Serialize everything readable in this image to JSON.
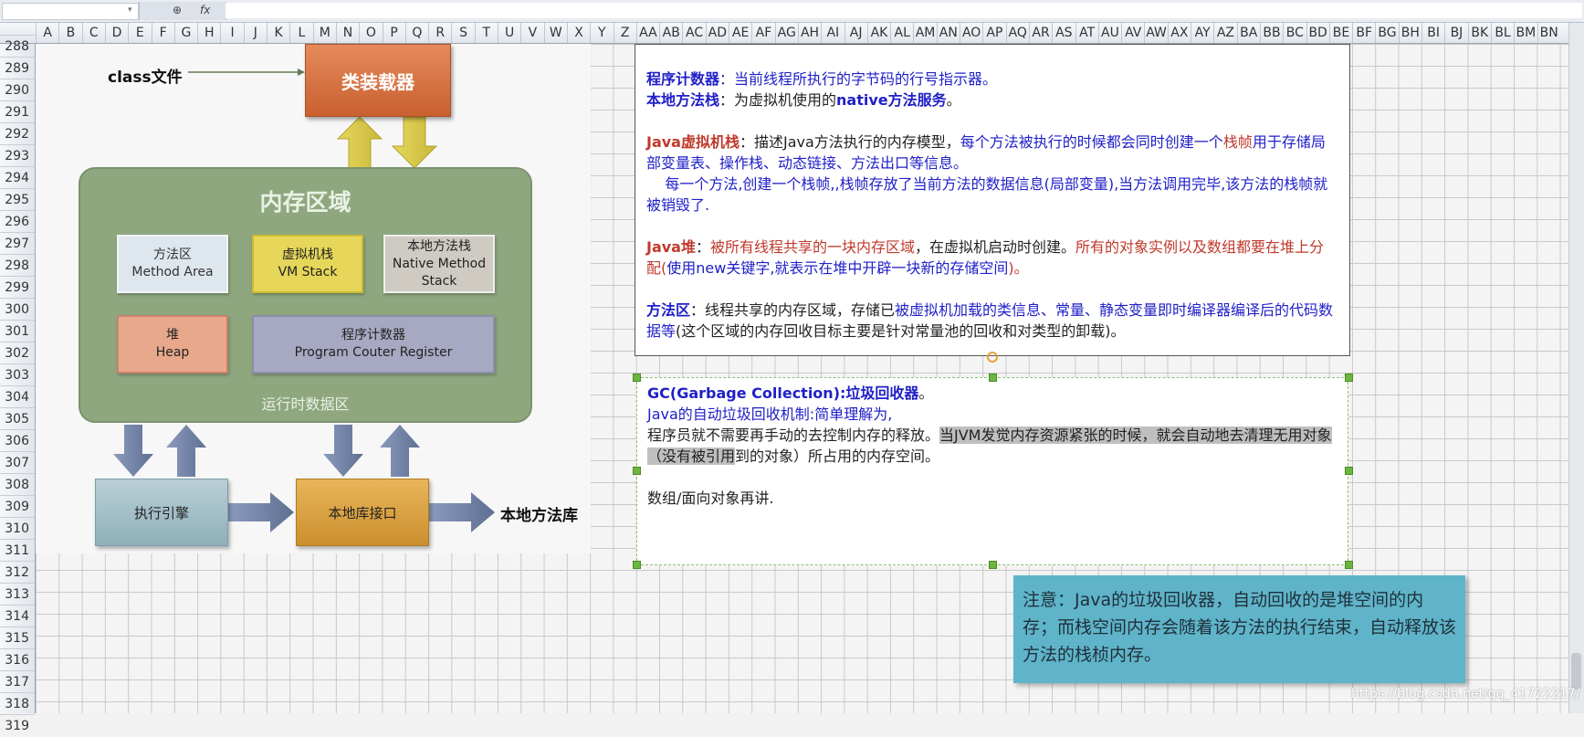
{
  "formula_bar": {
    "fx_label": "fx",
    "zoom_icon": "search-icon"
  },
  "columns": [
    "A",
    "B",
    "C",
    "D",
    "E",
    "F",
    "G",
    "H",
    "I",
    "J",
    "K",
    "L",
    "M",
    "N",
    "O",
    "P",
    "Q",
    "R",
    "S",
    "T",
    "U",
    "V",
    "W",
    "X",
    "Y",
    "Z",
    "AA",
    "AB",
    "AC",
    "AD",
    "AE",
    "AF",
    "AG",
    "AH",
    "AI",
    "AJ",
    "AK",
    "AL",
    "AM",
    "AN",
    "AO",
    "AP",
    "AQ",
    "AR",
    "AS",
    "AT",
    "AU",
    "AV",
    "AW",
    "AX",
    "AY",
    "AZ",
    "BA",
    "BB",
    "BC",
    "BD",
    "BE",
    "BF",
    "BG",
    "BH",
    "BI",
    "BJ",
    "BK",
    "BL",
    "BM",
    "BN"
  ],
  "rows": [
    "288",
    "289",
    "290",
    "291",
    "292",
    "293",
    "294",
    "295",
    "296",
    "297",
    "298",
    "299",
    "300",
    "301",
    "302",
    "303",
    "304",
    "305",
    "306",
    "307",
    "308",
    "309",
    "310",
    "311",
    "312",
    "313",
    "314",
    "315",
    "316",
    "317",
    "318",
    "319"
  ],
  "diagram": {
    "class_file": "class文件",
    "class_loader": "类装载器",
    "memory_title": "内存区域",
    "method_area": {
      "cn": "方法区",
      "en": "Method Area"
    },
    "vm_stack": {
      "cn": "虚拟机栈",
      "en": "VM Stack"
    },
    "native_stack": {
      "cn": "本地方法栈",
      "en1": "Native Method",
      "en2": "Stack"
    },
    "heap": {
      "cn": "堆",
      "en": "Heap"
    },
    "pc_register": {
      "cn": "程序计数器",
      "en": "Program Couter Register"
    },
    "runtime_area": "运行时数据区",
    "exec_engine": "执行引擎",
    "native_interface": "本地库接口",
    "native_library": "本地方法库"
  },
  "textbox": {
    "pc_term": "程序计数器",
    "pc_desc": "：当前线程所执行的字节码的行号指示器。",
    "nms_term": "本地方法栈",
    "nms_desc1": "：为虚拟机使用的",
    "nms_desc2": "native方法服务",
    "nms_desc3": "。",
    "vms_term": "Java虚拟机栈",
    "vms_desc1": "：描述Java方法执行的内存模型，",
    "vms_desc2": "每个方法被执行的时候都会同时创建一个",
    "vms_desc3": "栈帧",
    "vms_desc4": "用于存储局部变量表、操作栈、动态链接、方法出口等信息。",
    "vms_desc5": "每一个方法,创建一个栈帧,,栈帧存放了当前方法的数据信息(局部变量),当方法调用完毕,该方法的栈帧就被销毁了.",
    "heap_term": "Java堆",
    "heap_desc1": "：",
    "heap_desc2": "被所有线程共享的一块内存区域",
    "heap_desc3": "，在虚拟机启动时创建。",
    "heap_desc4": "所有的对象实例以及数组都要在堆上分配(",
    "heap_desc5": "使用new关键字,就表示在堆中开辟一块新的存储空间",
    "heap_desc6": ")。",
    "ma_term": "方法区",
    "ma_desc1": "：线程共享的内存区域，存储已",
    "ma_desc2": "被虚拟机加载的类信息、常量、静态变量即时编译器编译后的代码数据等",
    "ma_desc3": "(这个区域的内存回收目标主要是针对常量池的回收和对类型的卸载)。"
  },
  "gc_box": {
    "gc_title1": "GC(Garbage Collection):",
    "gc_title2": "垃圾回收器",
    "gc_title3": "。",
    "gc_line2": "Java的自动垃圾回收机制:简单理解为,",
    "gc_line3a": "程序员就不需要再手动的去控制内存的释放。",
    "gc_line3b": "当JVM发觉内存资源紧张的时候，就会自动地去清理无用对象（没有被引用",
    "gc_line3c": "到的对象）所占用的内存空间。",
    "gc_line4": "数组/面向对象再讲."
  },
  "note": {
    "text": "注意：Java的垃圾回收器，自动回收的是堆空间的内存；而栈空间内存会随着该方法的执行结束，自动释放该方法的栈桢内存。"
  },
  "watermark": "https://blog.csdn.net/qq_41722217/"
}
